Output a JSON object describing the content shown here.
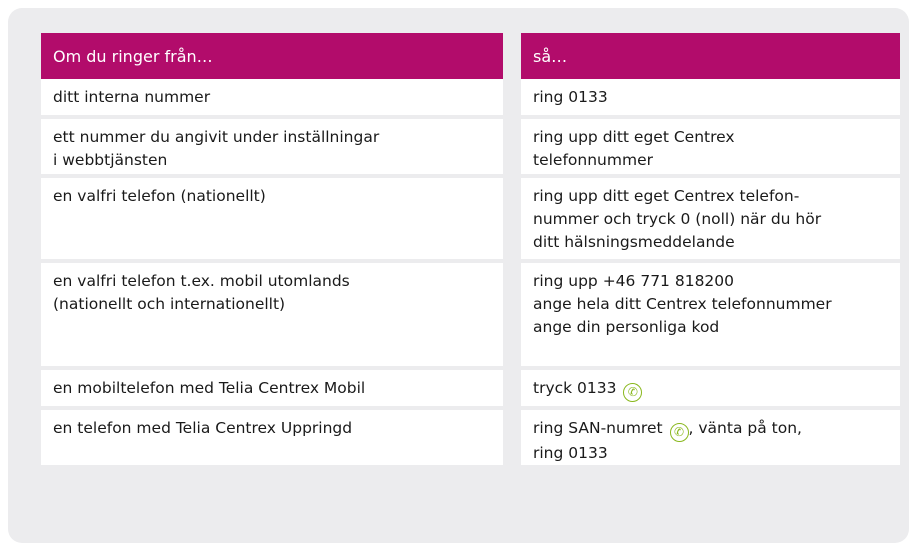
{
  "header": {
    "col1": "Om du ringer från…",
    "col2": "så…"
  },
  "rows": [
    {
      "from": [
        "ditt interna nummer"
      ],
      "then": [
        "ring 0133"
      ]
    },
    {
      "from": [
        "ett nummer du angivit under inställningar",
        "i webbtjänsten"
      ],
      "then": [
        "ring upp ditt eget Centrex",
        "telefonnummer"
      ]
    },
    {
      "from": [
        "en valfri telefon (nationellt)"
      ],
      "then": [
        "ring upp ditt eget Centrex telefon-",
        "nummer och tryck 0 (noll) när du hör",
        "ditt hälsningsmeddelande"
      ]
    },
    {
      "from": [
        "en valfri telefon t.ex. mobil utomlands",
        "(nationellt och internationellt)"
      ],
      "then": [
        "ring upp +46 771 818200",
        "ange hela ditt Centrex telefonnummer",
        "ange din personliga kod"
      ]
    },
    {
      "from": [
        "en mobiltelefon med Telia Centrex Mobil"
      ],
      "then_prefix": "tryck 0133 ",
      "then_icon": "phone-icon"
    },
    {
      "from": [
        "en telefon med Telia Centrex Uppringd"
      ],
      "then_prefix": "ring SAN-numret ",
      "then_icon": "phone-icon",
      "then_suffix": ", vänta på ton,",
      "then_line2": "ring 0133"
    }
  ],
  "colors": {
    "header_bg": "#b20c6b",
    "panel_bg": "#ececee",
    "icon": "#8ab81e"
  }
}
